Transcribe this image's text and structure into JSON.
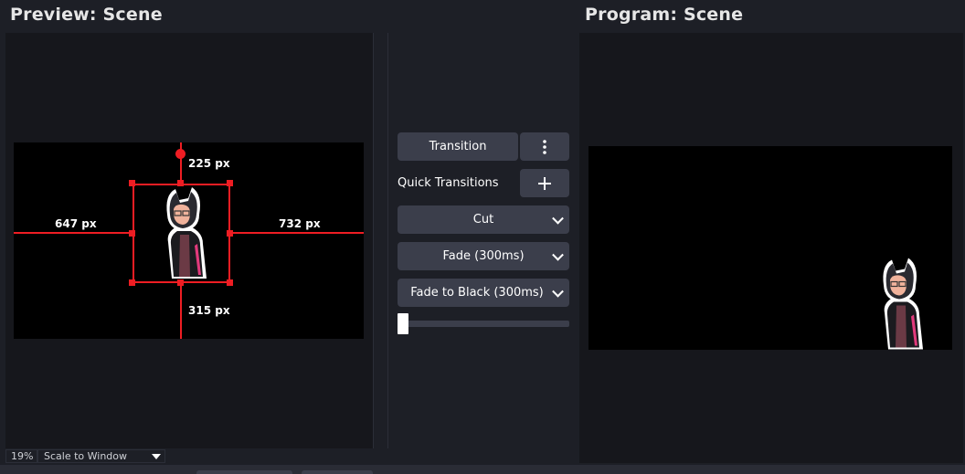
{
  "preview": {
    "title": "Preview: Scene",
    "guides": {
      "top": "225 px",
      "left": "647 px",
      "right": "732 px",
      "bottom": "315 px"
    },
    "zoom": "19%",
    "scale_mode": "Scale to Window"
  },
  "program": {
    "title": "Program: Scene"
  },
  "transitions": {
    "transition_button": "Transition",
    "more_icon": "kebab-menu-icon",
    "quick_transitions_label": "Quick Transitions",
    "add_icon": "plus-icon",
    "items": [
      "Cut",
      "Fade (300ms)",
      "Fade to Black (300ms)"
    ],
    "t_bar_position": 0
  },
  "colors": {
    "guide_red": "#ee1d23",
    "button_bg": "#3b3e4b",
    "background": "#1d1f26"
  }
}
